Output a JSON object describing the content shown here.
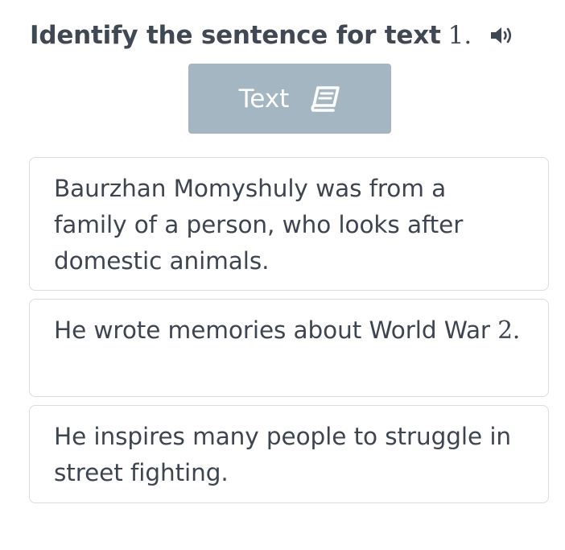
{
  "question": {
    "title": "Identify the sentence for text",
    "number": "1."
  },
  "text_button": {
    "label": "Text",
    "icon": "book-icon"
  },
  "speaker": {
    "icon": "speaker-icon"
  },
  "options": [
    {
      "text": "Baurzhan Momyshuly was from a family of a person, who looks after domestic animals."
    },
    {
      "text_main": "He wrote memories about World War",
      "text_num": "2."
    },
    {
      "text": "He inspires many people to struggle in street fighting."
    }
  ],
  "colors": {
    "title": "#3f4853",
    "text": "#3c4550",
    "button_bg": "#a3b6c2",
    "button_text": "#ffffff",
    "border": "#d9dde1"
  }
}
